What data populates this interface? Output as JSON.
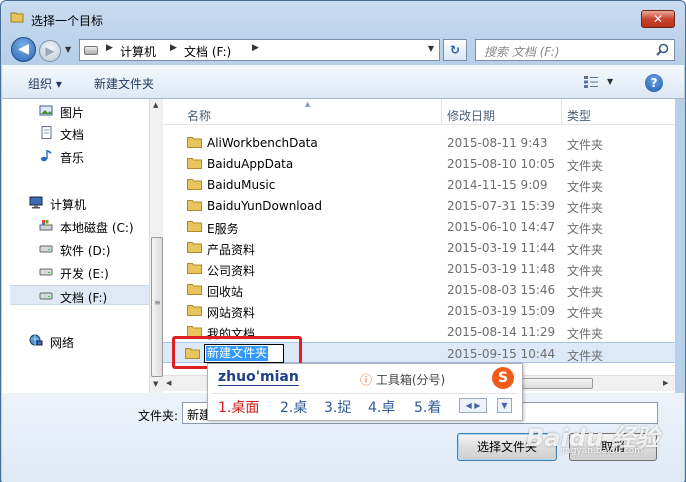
{
  "window": {
    "title": "选择一个目标",
    "close_label": "✕"
  },
  "address": {
    "crumbs": [
      "计算机",
      "文档 (F:)"
    ],
    "search_placeholder": "搜索 文档 (F:)"
  },
  "toolbar": {
    "organize": "组织 ▾",
    "new_folder": "新建文件夹",
    "help": "?"
  },
  "nav": {
    "items": [
      {
        "label": "图片",
        "icon": "pictures-icon"
      },
      {
        "label": "文档",
        "icon": "documents-icon"
      },
      {
        "label": "音乐",
        "icon": "music-icon"
      },
      {
        "label": "计算机",
        "icon": "computer-icon"
      },
      {
        "label": "本地磁盘 (C:)",
        "icon": "system-drive-icon"
      },
      {
        "label": "软件 (D:)",
        "icon": "drive-icon"
      },
      {
        "label": "开发 (E:)",
        "icon": "drive-icon"
      },
      {
        "label": "文档 (F:)",
        "icon": "drive-icon",
        "selected": true
      },
      {
        "label": "网络",
        "icon": "network-icon"
      }
    ]
  },
  "columns": {
    "name": "名称",
    "date": "修改日期",
    "type": "类型"
  },
  "files": [
    {
      "name": "AliWorkbenchData",
      "date": "2015-08-11 9:43",
      "type": "文件夹"
    },
    {
      "name": "BaiduAppData",
      "date": "2015-08-10 10:05",
      "type": "文件夹"
    },
    {
      "name": "BaiduMusic",
      "date": "2014-11-15 9:09",
      "type": "文件夹"
    },
    {
      "name": "BaiduYunDownload",
      "date": "2015-07-31 15:39",
      "type": "文件夹"
    },
    {
      "name": "E服务",
      "date": "2015-06-10 14:47",
      "type": "文件夹"
    },
    {
      "name": "产品资料",
      "date": "2015-03-19 11:44",
      "type": "文件夹"
    },
    {
      "name": "公司资料",
      "date": "2015-03-19 11:48",
      "type": "文件夹"
    },
    {
      "name": "回收站",
      "date": "2015-08-03 15:46",
      "type": "文件夹"
    },
    {
      "name": "网站资料",
      "date": "2015-03-19 15:09",
      "type": "文件夹"
    },
    {
      "name": "我的文档",
      "date": "2015-08-14 11:29",
      "type": "文件夹"
    }
  ],
  "editing_row": {
    "name": "新建文件夹",
    "date": "2015-09-15 10:44",
    "type": "文件夹"
  },
  "ime": {
    "composition": "zhuo'mian",
    "toolbox": "工具箱(分号)",
    "logo": "S",
    "candidates": [
      "1.桌面",
      "2.桌",
      "3.捉",
      "4.卓",
      "5.着"
    ]
  },
  "bottom": {
    "filename_label": "文件夹:",
    "filename_value": "新建",
    "select_button": "选择文件夹",
    "cancel_button": "取消"
  },
  "watermark": {
    "brand": "Baidu 经验",
    "url": "jingyan.baidu.com"
  }
}
